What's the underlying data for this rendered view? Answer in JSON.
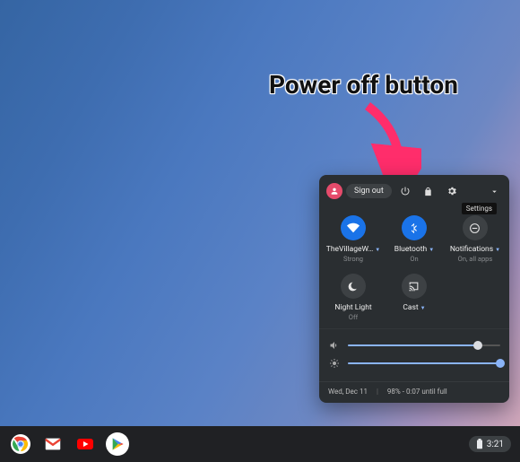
{
  "annotation": {
    "label": "Power off button"
  },
  "panel": {
    "sign_out_label": "Sign out",
    "tooltip": "Settings",
    "tiles": {
      "wifi": {
        "label": "TheVillageW…",
        "sub": "Strong"
      },
      "bluetooth": {
        "label": "Bluetooth",
        "sub": "On"
      },
      "notifications": {
        "label": "Notifications",
        "sub": "On, all apps"
      },
      "nightlight": {
        "label": "Night Light",
        "sub": "Off"
      },
      "cast": {
        "label": "Cast",
        "sub": ""
      }
    },
    "volume_pct": 85,
    "brightness_pct": 100,
    "date": "Wed, Dec 11",
    "battery_text": "98% - 0:07 until full"
  },
  "shelf": {
    "battery_icon_pct": 98,
    "clock": "3:21"
  }
}
